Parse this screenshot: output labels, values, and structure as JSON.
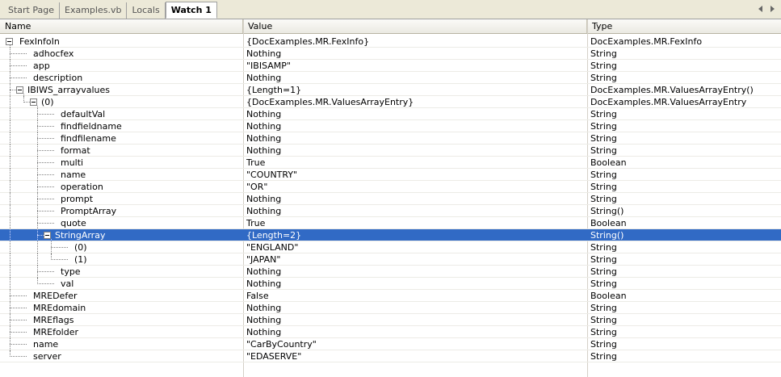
{
  "tabs": [
    "Start Page",
    "Examples.vb",
    "Locals",
    "Watch 1"
  ],
  "active_tab": 3,
  "columns": {
    "name": "Name",
    "value": "Value",
    "type": "Type"
  },
  "rows": [
    {
      "name": "FexInfoIn",
      "value": "{DocExamples.MR.FexInfo}",
      "type": "DocExamples.MR.FexInfo",
      "depth": 0,
      "expanded": true
    },
    {
      "name": "adhocfex",
      "value": "Nothing",
      "type": "String",
      "depth": 1
    },
    {
      "name": "app",
      "value": "\"IBISAMP\"",
      "type": "String",
      "depth": 1
    },
    {
      "name": "description",
      "value": "Nothing",
      "type": "String",
      "depth": 1
    },
    {
      "name": "IBIWS_arrayvalues",
      "value": "{Length=1}",
      "type": "DocExamples.MR.ValuesArrayEntry()",
      "depth": 1,
      "expanded": true
    },
    {
      "name": "(0)",
      "value": "{DocExamples.MR.ValuesArrayEntry}",
      "type": "DocExamples.MR.ValuesArrayEntry",
      "depth": 2,
      "expanded": true
    },
    {
      "name": "defaultVal",
      "value": "Nothing",
      "type": "String",
      "depth": 3
    },
    {
      "name": "findfieldname",
      "value": "Nothing",
      "type": "String",
      "depth": 3
    },
    {
      "name": "findfilename",
      "value": "Nothing",
      "type": "String",
      "depth": 3
    },
    {
      "name": "format",
      "value": "Nothing",
      "type": "String",
      "depth": 3
    },
    {
      "name": "multi",
      "value": "True",
      "type": "Boolean",
      "depth": 3
    },
    {
      "name": "name",
      "value": "\"COUNTRY\"",
      "type": "String",
      "depth": 3
    },
    {
      "name": "operation",
      "value": "\"OR\"",
      "type": "String",
      "depth": 3
    },
    {
      "name": "prompt",
      "value": "Nothing",
      "type": "String",
      "depth": 3
    },
    {
      "name": "PromptArray",
      "value": "Nothing",
      "type": "String()",
      "depth": 3
    },
    {
      "name": "quote",
      "value": "True",
      "type": "Boolean",
      "depth": 3
    },
    {
      "name": "StringArray",
      "value": "{Length=2}",
      "type": "String()",
      "depth": 3,
      "expanded": true,
      "selected": true
    },
    {
      "name": "(0)",
      "value": "\"ENGLAND\"",
      "type": "String",
      "depth": 4
    },
    {
      "name": "(1)",
      "value": "\"JAPAN\"",
      "type": "String",
      "depth": 4
    },
    {
      "name": "type",
      "value": "Nothing",
      "type": "String",
      "depth": 3
    },
    {
      "name": "val",
      "value": "Nothing",
      "type": "String",
      "depth": 3
    },
    {
      "name": "MREDefer",
      "value": "False",
      "type": "Boolean",
      "depth": 1
    },
    {
      "name": "MREdomain",
      "value": "Nothing",
      "type": "String",
      "depth": 1
    },
    {
      "name": "MREflags",
      "value": "Nothing",
      "type": "String",
      "depth": 1
    },
    {
      "name": "MREfolder",
      "value": "Nothing",
      "type": "String",
      "depth": 1
    },
    {
      "name": "name",
      "value": "\"CarByCountry\"",
      "type": "String",
      "depth": 1
    },
    {
      "name": "server",
      "value": "\"EDASERVE\"",
      "type": "String",
      "depth": 1
    }
  ]
}
